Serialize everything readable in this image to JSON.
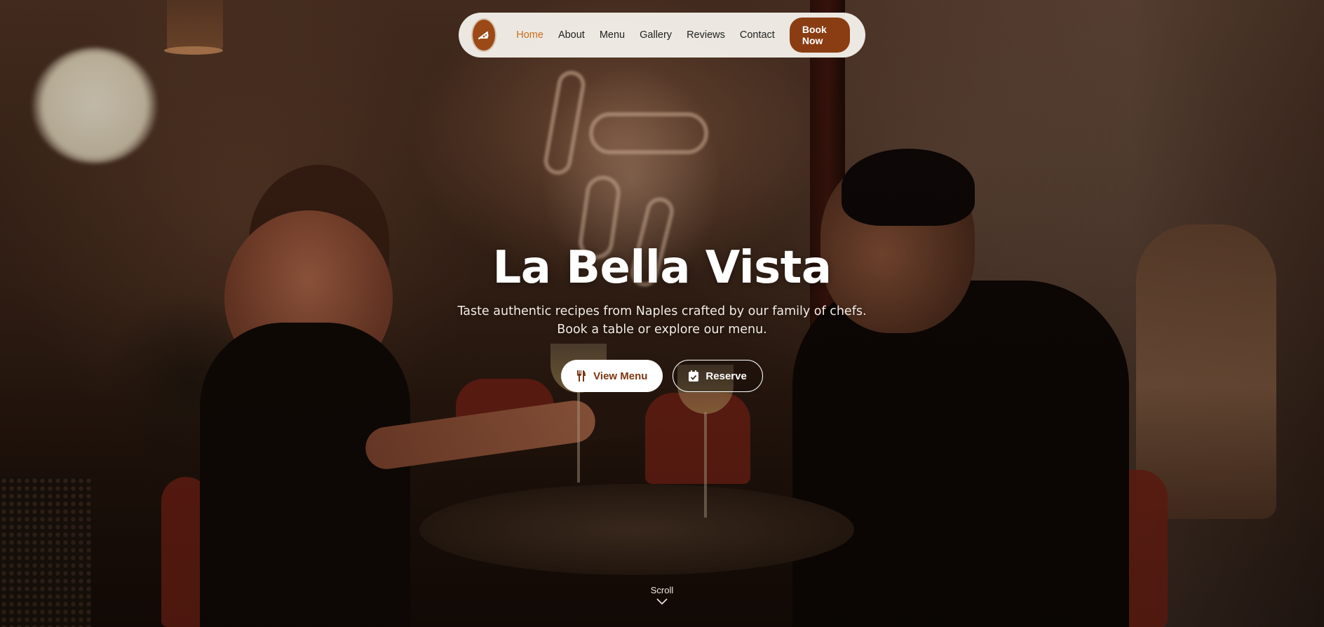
{
  "nav": {
    "links": [
      "Home",
      "About",
      "Menu",
      "Gallery",
      "Reviews",
      "Contact"
    ],
    "active": "Home",
    "book_label": "Book Now",
    "logo_icon": "pizza-slice-icon"
  },
  "hero": {
    "title": "La Bella Vista",
    "subtitle": "Taste authentic recipes from Naples crafted by our family of chefs. Book a table or explore our menu.",
    "primary_cta": {
      "label": "View Menu",
      "icon": "utensils-icon"
    },
    "secondary_cta": {
      "label": "Reserve",
      "icon": "calendar-check-icon"
    }
  },
  "scroll": {
    "label": "Scroll",
    "icon": "chevron-down-icon"
  },
  "colors": {
    "accent": "#8a3d12",
    "active_link": "#c96c1f",
    "logo_bg": "#9b4a17"
  }
}
